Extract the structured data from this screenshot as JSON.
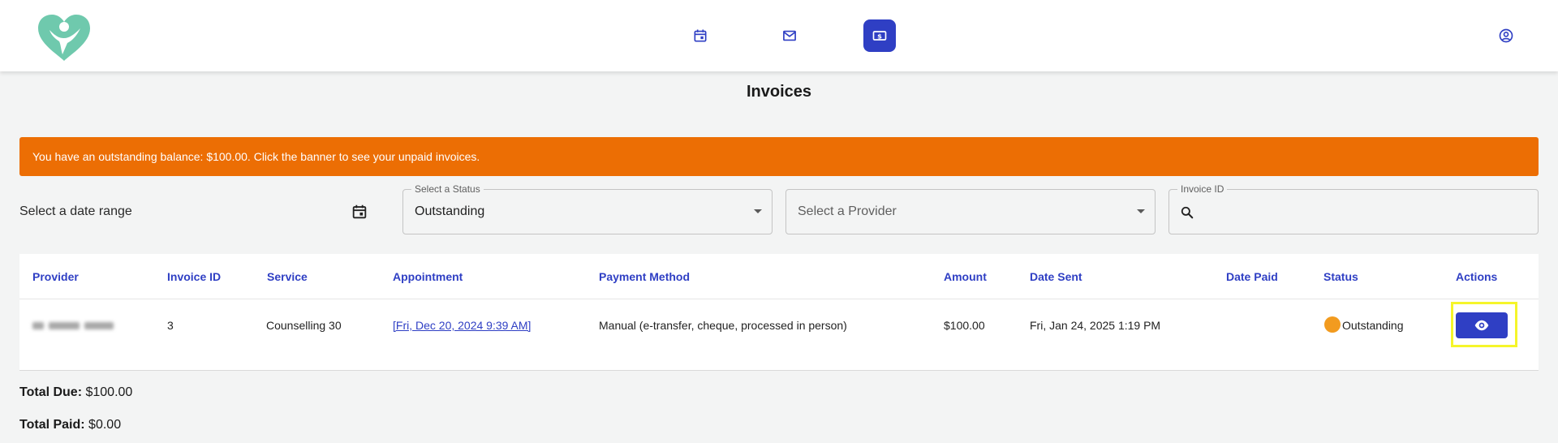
{
  "nav": {
    "items": [
      {
        "name": "calendar",
        "icon": "calendar-icon"
      },
      {
        "name": "messages",
        "icon": "mail-icon"
      },
      {
        "name": "invoices",
        "icon": "dollar-bill-icon",
        "active": true
      }
    ],
    "profile_icon": "account-circle-icon"
  },
  "page": {
    "title": "Invoices"
  },
  "banner": {
    "text": "You have an outstanding balance: $100.00. Click the banner to see your unpaid invoices."
  },
  "filters": {
    "date_range_label": "Select a date range",
    "status": {
      "legend": "Select a Status",
      "value": "Outstanding"
    },
    "provider": {
      "placeholder": "Select a Provider"
    },
    "invoice_id": {
      "legend": "Invoice ID",
      "value": ""
    }
  },
  "table": {
    "headers": [
      "Provider",
      "Invoice ID",
      "Service",
      "Appointment",
      "Payment Method",
      "Amount",
      "Date Sent",
      "Date Paid",
      "Status",
      "Actions"
    ],
    "rows": [
      {
        "invoice_id": "3",
        "service": "Counselling 30",
        "appointment": "[Fri, Dec 20, 2024 9:39 AM]",
        "payment_method": "Manual (e-transfer, cheque, processed in person)",
        "amount": "$100.00",
        "date_sent": "Fri, Jan 24, 2025 1:19 PM",
        "date_paid": "",
        "status": "Outstanding"
      }
    ]
  },
  "totals": {
    "due_label": "Total Due:",
    "due_value": "$100.00",
    "paid_label": "Total Paid:",
    "paid_value": "$0.00"
  },
  "colors": {
    "primary": "#2f3fc4",
    "banner": "#ec6e04",
    "status_outstanding": "#f29b1f",
    "logo": "#6fc9ad"
  }
}
